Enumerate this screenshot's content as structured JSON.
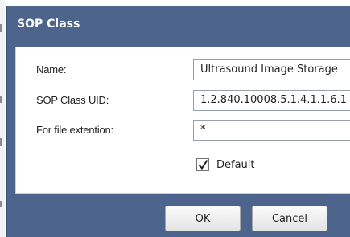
{
  "dialog": {
    "title": "SOP Class",
    "fields": {
      "name_label": "Name:",
      "name_value": "Ultrasound Image Storage",
      "uid_label": "SOP Class UID:",
      "uid_value": "1.2.840.10008.5.1.4.1.1.6.1",
      "ext_label": "For file extention:",
      "ext_value": "*"
    },
    "default_checkbox": {
      "label": "Default",
      "checked": true
    },
    "buttons": {
      "ok": "OK",
      "cancel": "Cancel"
    }
  }
}
